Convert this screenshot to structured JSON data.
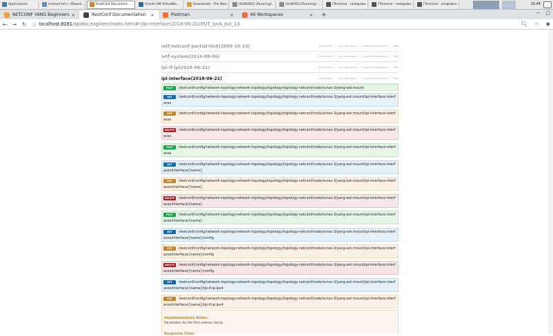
{
  "taskbar": {
    "items": [
      {
        "label": "Applications",
        "color": "#3b78c2"
      },
      {
        "label": "instruct.txt (~/Downl...",
        "color": "#5d8fcf"
      },
      {
        "label": "RestConf Document...",
        "color": "#d9822b"
      },
      {
        "label": "Oracle VM VirtualBo...",
        "color": "#2c67b3"
      },
      {
        "label": "Downloads - File Man...",
        "color": "#e0a32f"
      },
      {
        "label": "[OcNOS01 [Running]...",
        "color": "#8b8b8b"
      },
      {
        "label": "[OcNOS3 [Running] -...",
        "color": "#8b8b8b"
      },
      {
        "label": "[Terminal - root@ubu...",
        "color": "#555555"
      },
      {
        "label": "[Terminal - root@ubu...",
        "color": "#555555"
      },
      {
        "label": "[Terminal - joe@ubun...",
        "color": "#555555"
      }
    ],
    "clock": "16:44"
  },
  "browser": {
    "tabs": [
      {
        "label": "NETCONF YANG Beginners",
        "favicon_color": "#e6a23c"
      },
      {
        "label": "RestConf Documentation",
        "favicon_color": "#444444",
        "active": true
      },
      {
        "label": "Postman",
        "favicon_color": "#f26b3a"
      },
      {
        "label": "All Workspaces",
        "favicon_color": "#f26b3a"
      }
    ],
    "new_tab": "+",
    "close_glyph": "×",
    "url_host": "localhost:8181",
    "url_path": "/apidoc/explorer/index.html#!/ipi-interface(2018-06-21)/PUT_ipv4_put_13"
  },
  "resource_links": [
    "Show/Hide",
    "List Operations",
    "Expand Operations",
    "Raw"
  ],
  "resources": [
    {
      "name": "ietf-netconf-partial-lock(2009-10-19)",
      "open": false
    },
    {
      "name": "ietf-system(2014-08-06)",
      "open": false
    },
    {
      "name": "ipi-if-ip(2018-06-21)",
      "open": false
    },
    {
      "name": "ipi-interface(2018-06-21)",
      "open": true
    }
  ],
  "operations": [
    {
      "method": "POST",
      "path": "/restconf/config/network-topology:network-topology/topology/topology-netconf/node/ocnos-3/yang-ext:mount"
    },
    {
      "method": "GET",
      "path": "/restconf/config/network-topology:network-topology/topology/topology-netconf/node/ocnos-3/yang-ext:mount/ipi-interface:interfaces"
    },
    {
      "method": "PUT",
      "path": "/restconf/config/network-topology:network-topology/topology/topology-netconf/node/ocnos-3/yang-ext:mount/ipi-interface:interfaces"
    },
    {
      "method": "DELETE",
      "path": "/restconf/config/network-topology:network-topology/topology/topology-netconf/node/ocnos-3/yang-ext:mount/ipi-interface:interfaces"
    },
    {
      "method": "POST",
      "path": "/restconf/config/network-topology:network-topology/topology/topology-netconf/node/ocnos-3/yang-ext:mount/ipi-interface:interfaces"
    },
    {
      "method": "GET",
      "path": "/restconf/config/network-topology:network-topology/topology/topology-netconf/node/ocnos-3/yang-ext:mount/ipi-interface:interfaces/interface/{name}"
    },
    {
      "method": "PUT",
      "path": "/restconf/config/network-topology:network-topology/topology/topology-netconf/node/ocnos-3/yang-ext:mount/ipi-interface:interfaces/interface/{name}"
    },
    {
      "method": "DELETE",
      "path": "/restconf/config/network-topology:network-topology/topology/topology-netconf/node/ocnos-3/yang-ext:mount/ipi-interface:interfaces/interface/{name}"
    },
    {
      "method": "POST",
      "path": "/restconf/config/network-topology:network-topology/topology/topology-netconf/node/ocnos-3/yang-ext:mount/ipi-interface:interfaces/interface/{name}"
    },
    {
      "method": "GET",
      "path": "/restconf/config/network-topology:network-topology/topology/topology-netconf/node/ocnos-3/yang-ext:mount/ipi-interface:interfaces/interface/{name}/config"
    },
    {
      "method": "PUT",
      "path": "/restconf/config/network-topology:network-topology/topology/topology-netconf/node/ocnos-3/yang-ext:mount/ipi-interface:interfaces/interface/{name}/config"
    },
    {
      "method": "DELETE",
      "path": "/restconf/config/network-topology:network-topology/topology/topology-netconf/node/ocnos-3/yang-ext:mount/ipi-interface:interfaces/interface/{name}/config"
    },
    {
      "method": "GET",
      "path": "/restconf/config/network-topology:network-topology/topology/topology-netconf/node/ocnos-3/yang-ext:mount/ipi-interface:interfaces/interface/{name}/ipi-if-ip:ipv4"
    },
    {
      "method": "PUT",
      "path": "/restconf/config/network-topology:network-topology/topology/topology-netconf/node/ocnos-3/yang-ext:mount/ipi-interface:interfaces/interface/{name}/ipi-if-ip:ipv4"
    }
  ],
  "implementation": {
    "title": "Implementation Notes",
    "description": "Parameters for the IPv4 address family",
    "next_heading": "Response Class"
  }
}
